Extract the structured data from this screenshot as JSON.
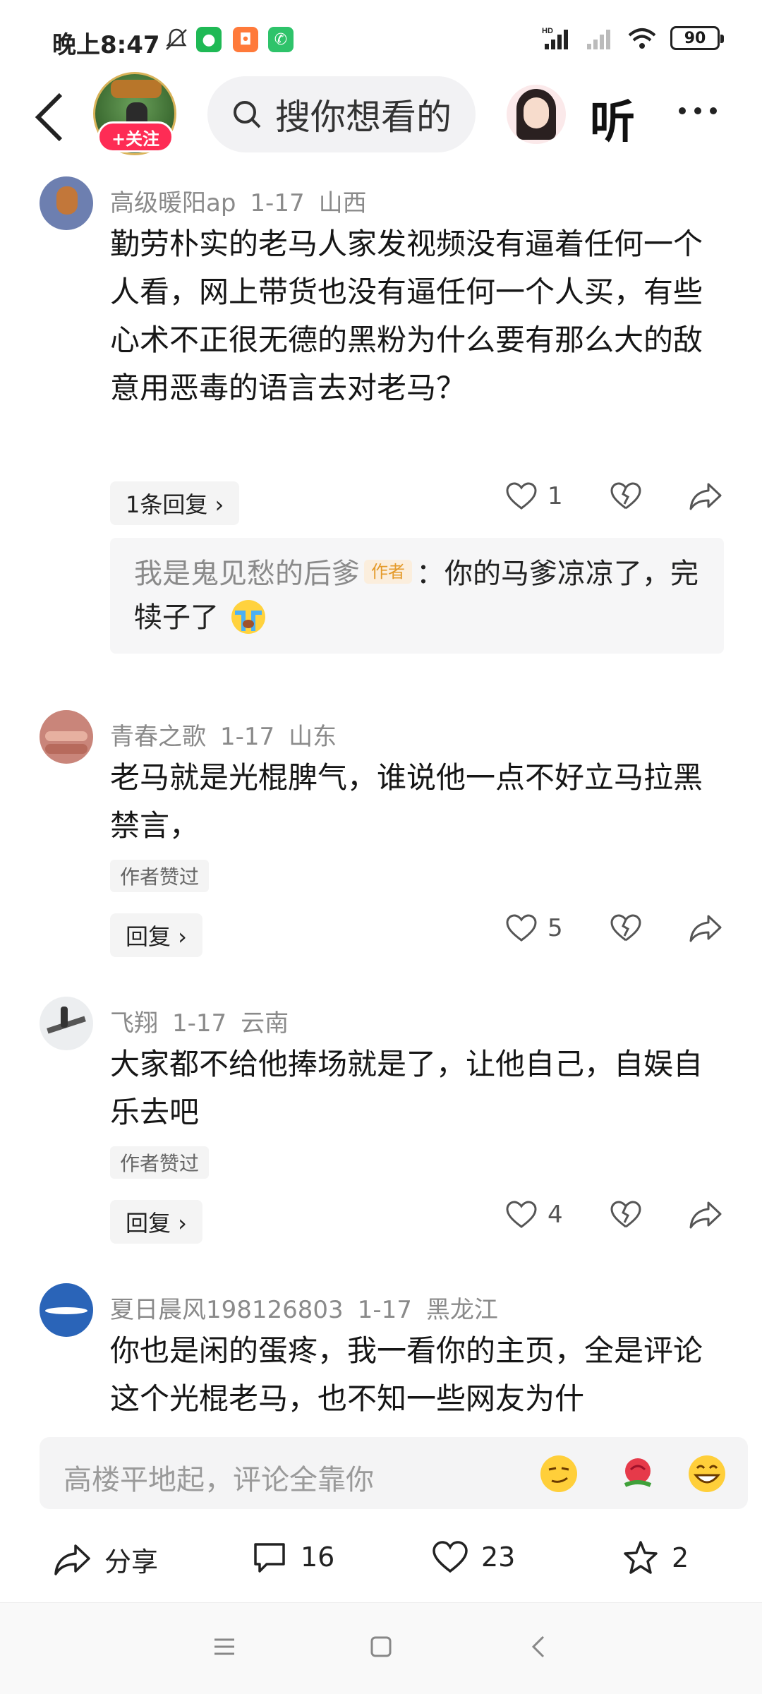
{
  "status_bar": {
    "time": "晚上8:47",
    "battery": "90",
    "network": "HD"
  },
  "header": {
    "follow_label": "+关注",
    "search_placeholder": "搜你想看的",
    "listen_label": "听"
  },
  "comments": [
    {
      "user": "高级暖阳ap",
      "date": "1-17",
      "location": "山西",
      "text": "勤劳朴实的老马人家发视频没有逼着任何一个人看，网上带货也没有逼任何一个人买，有些心术不正很无德的黑粉为什么要有那么大的敌意用恶毒的语言去对老马？",
      "reply_label": "1条回复 ›",
      "likes": "1",
      "sub_reply": {
        "user": "我是鬼见愁的后爹",
        "tag": "作者",
        "text": "：你的马爹凉凉了，完犊子了"
      }
    },
    {
      "user": "青春之歌",
      "date": "1-17",
      "location": "山东",
      "text": "老马就是光棍脾气，谁说他一点不好立马拉黑禁言，",
      "liked_label": "作者赞过",
      "reply_label": "回复 ›",
      "likes": "5"
    },
    {
      "user": "飞翔",
      "date": "1-17",
      "location": "云南",
      "text": "大家都不给他捧场就是了，让他自己，自娱自乐去吧",
      "liked_label": "作者赞过",
      "reply_label": "回复 ›",
      "likes": "4"
    },
    {
      "user": "夏日晨风198126803",
      "date": "1-17",
      "location": "黑龙江",
      "text": "你也是闲的蛋疼，我一看你的主页，全是评论这个光棍老马，也不知一些网友为什"
    }
  ],
  "comment_input": {
    "placeholder": "高楼平地起，评论全靠你"
  },
  "bottom_bar": {
    "share_label": "分享",
    "comments_count": "16",
    "likes_count": "23",
    "favorites_count": "2"
  }
}
